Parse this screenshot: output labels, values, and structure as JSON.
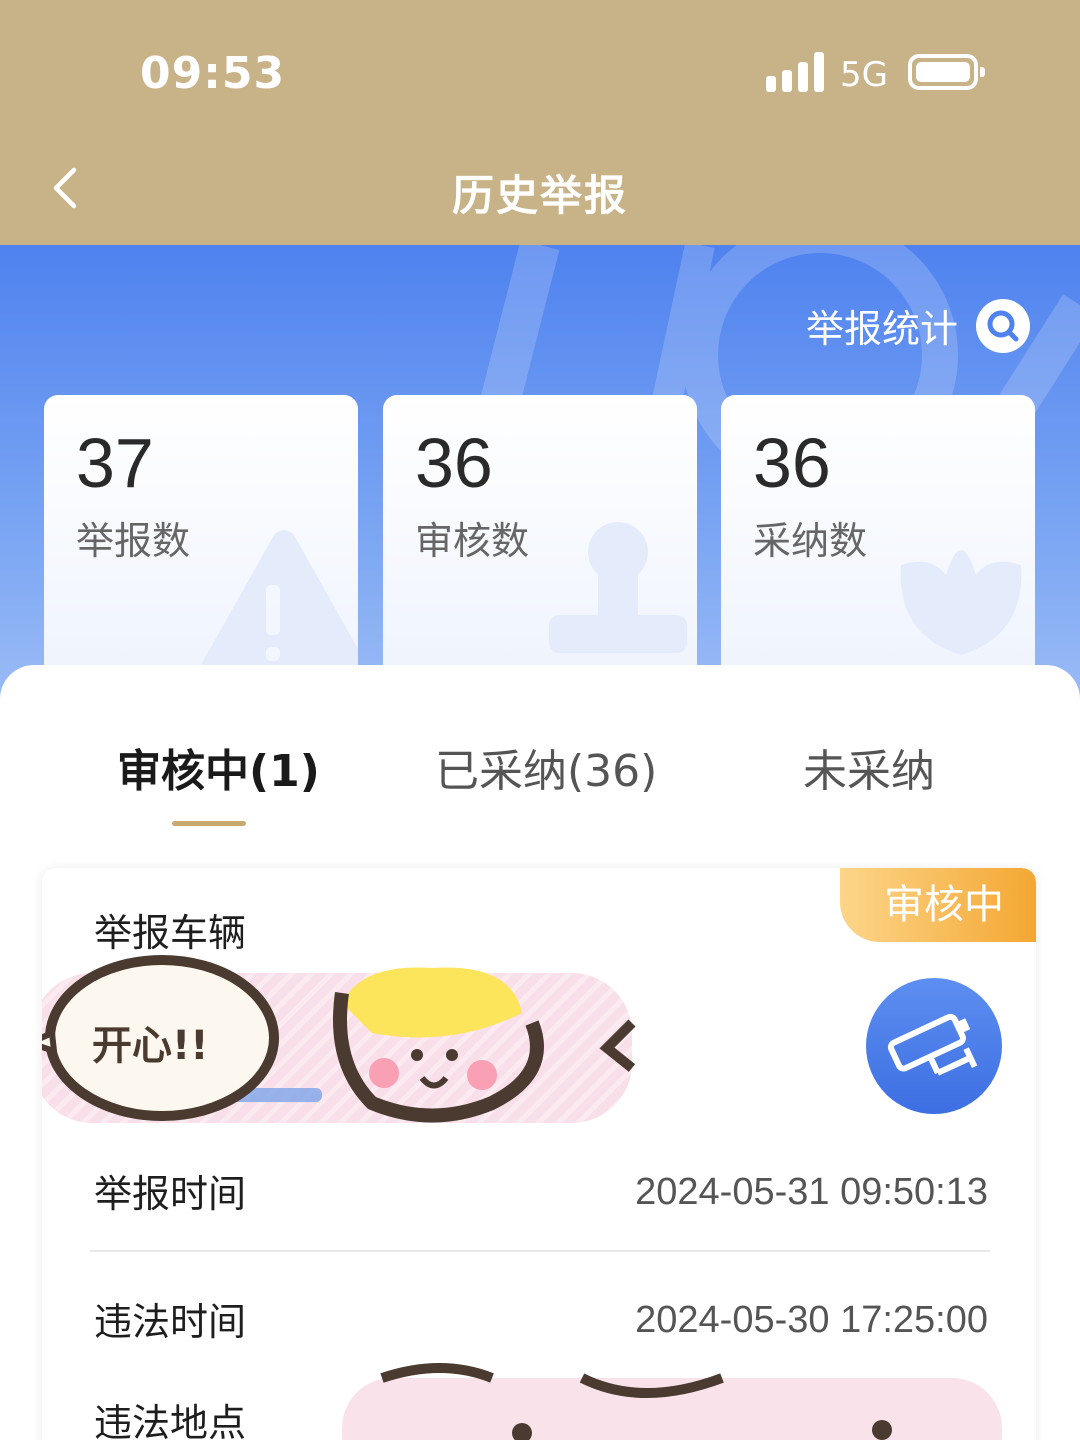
{
  "status_bar": {
    "time": "09:53",
    "network": "5G"
  },
  "header": {
    "title": "历史举报"
  },
  "stats_link": {
    "label": "举报统计"
  },
  "stat_cards": [
    {
      "value": "37",
      "label": "举报数"
    },
    {
      "value": "36",
      "label": "审核数"
    },
    {
      "value": "36",
      "label": "采纳数"
    }
  ],
  "tabs": [
    {
      "label": "审核中(1)",
      "active": true
    },
    {
      "label": "已采纳(36)",
      "active": false
    },
    {
      "label": "未采纳",
      "active": false
    }
  ],
  "report": {
    "status": "审核中",
    "vehicle_label": "举报车辆",
    "report_time_label": "举报时间",
    "report_time": "2024-05-31 09:50:13",
    "violation_time_label": "违法时间",
    "violation_time": "2024-05-30 17:25:00",
    "violation_place_label": "违法地点",
    "sticker_text": "开心!!"
  },
  "colors": {
    "header_bg": "#c8b288",
    "band_blue": "#4f82ef",
    "accent_gold": "#c8a96e",
    "badge_orange": "#f4a732"
  },
  "icons": [
    "back-icon",
    "signal-icon",
    "battery-icon",
    "search-icon",
    "camera-icon"
  ]
}
